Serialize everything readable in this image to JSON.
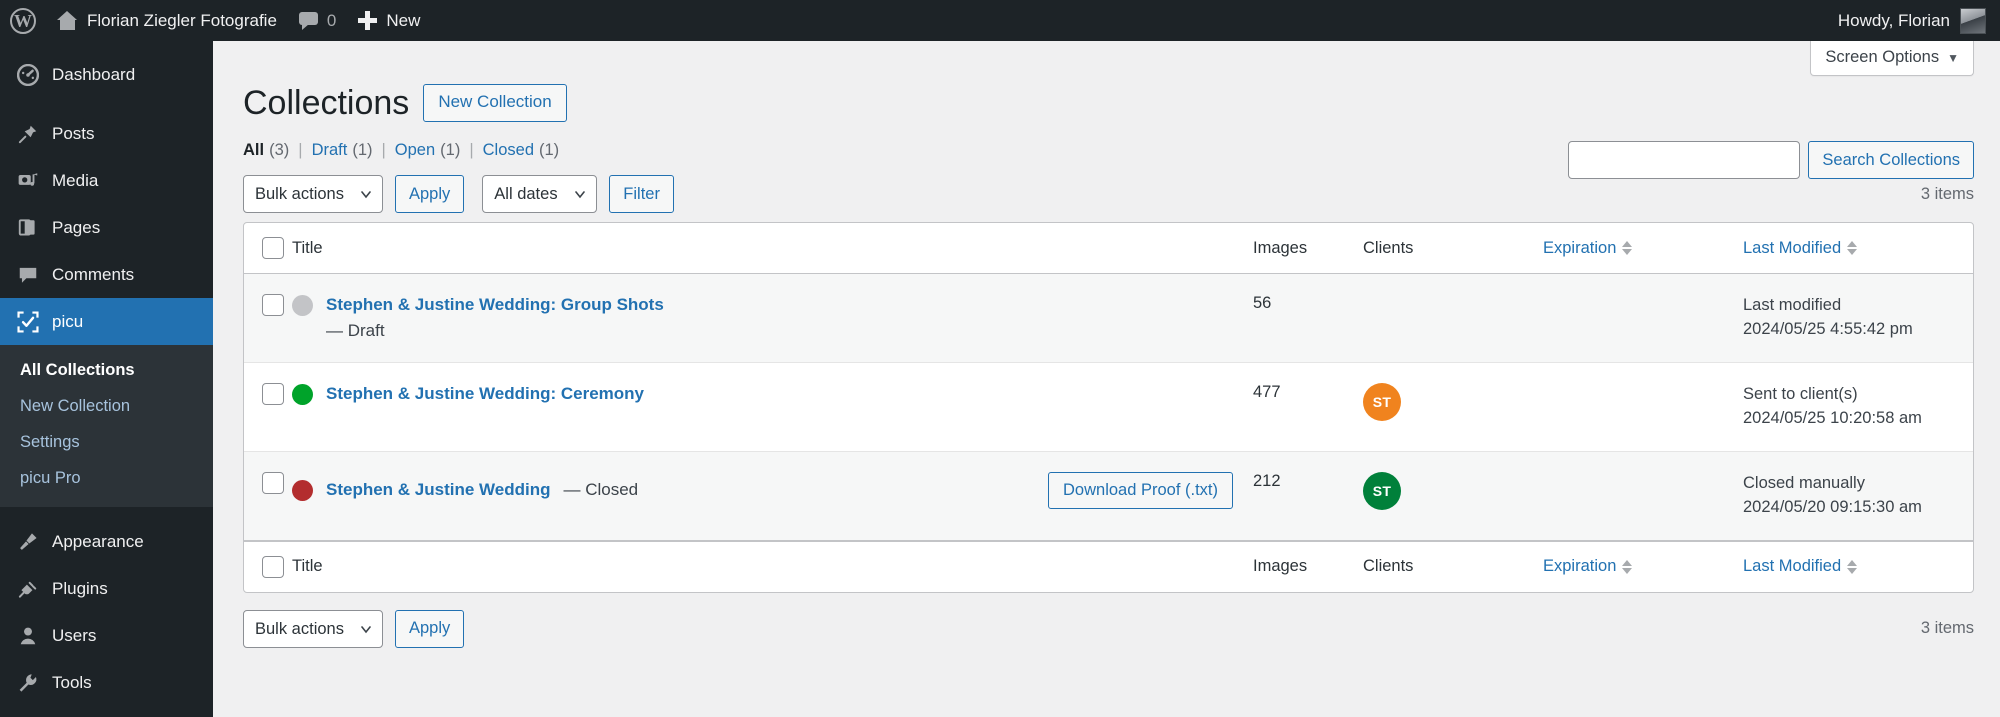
{
  "adminbar": {
    "wp_logo_icon": "wordpress-logo-icon",
    "home_icon": "home-icon",
    "site_name": "Florian Ziegler Fotografie",
    "comments_icon": "comment-bubble-icon",
    "comments_count": "0",
    "new_icon": "plus-icon",
    "new_label": "New",
    "howdy": "Howdy, Florian",
    "avatar_icon": "user-avatar"
  },
  "sidebar": {
    "items": [
      {
        "label": "Dashboard",
        "icon": "dashboard-icon",
        "current": false
      },
      {
        "label": "Posts",
        "icon": "pin-icon",
        "current": false
      },
      {
        "label": "Media",
        "icon": "media-icon",
        "current": false
      },
      {
        "label": "Pages",
        "icon": "pages-icon",
        "current": false
      },
      {
        "label": "Comments",
        "icon": "comment-bubble-icon",
        "current": false
      },
      {
        "label": "picu",
        "icon": "picu-checkbox-icon",
        "current": true
      },
      {
        "label": "Appearance",
        "icon": "paintbrush-icon",
        "current": false
      },
      {
        "label": "Plugins",
        "icon": "plug-icon",
        "current": false
      },
      {
        "label": "Users",
        "icon": "user-icon",
        "current": false
      },
      {
        "label": "Tools",
        "icon": "wrench-icon",
        "current": false
      }
    ],
    "submenu": [
      {
        "label": "All Collections",
        "current": true
      },
      {
        "label": "New Collection",
        "current": false
      },
      {
        "label": "Settings",
        "current": false
      },
      {
        "label": "picu Pro",
        "current": false
      }
    ]
  },
  "screen_options": {
    "label": "Screen Options",
    "caret_icon": "caret-down-icon"
  },
  "page": {
    "title": "Collections",
    "action_label": "New Collection"
  },
  "views": {
    "items": [
      {
        "label": "All",
        "count": "(3)",
        "current": true
      },
      {
        "label": "Draft",
        "count": "(1)",
        "current": false
      },
      {
        "label": "Open",
        "count": "(1)",
        "current": false
      },
      {
        "label": "Closed",
        "count": "(1)",
        "current": false
      }
    ],
    "divider": "|"
  },
  "search": {
    "value": "",
    "placeholder": "",
    "button_label": "Search Collections"
  },
  "tablenav_top": {
    "bulk_actions_selected": "Bulk actions",
    "apply_label": "Apply",
    "dates_selected": "All dates",
    "filter_label": "Filter",
    "displaying_num": "3 items"
  },
  "tablenav_bottom": {
    "bulk_actions_selected": "Bulk actions",
    "apply_label": "Apply",
    "displaying_num": "3 items"
  },
  "table": {
    "columns": {
      "title": "Title",
      "images": "Images",
      "clients": "Clients",
      "expiration": "Expiration",
      "last_modified": "Last Modified"
    },
    "rows": [
      {
        "status_color": "#c3c4c7",
        "status_name": "draft",
        "title": "Stephen & Justine Wedding: Group Shots",
        "state_suffix": "",
        "substate": "— Draft",
        "proof_button": "",
        "images": "56",
        "client_initials": "",
        "client_color": "",
        "modified_status": "Last modified",
        "modified_date": "2024/05/25 4:55:42 pm"
      },
      {
        "status_color": "#00a32a",
        "status_name": "open",
        "title": "Stephen & Justine Wedding: Ceremony",
        "state_suffix": "",
        "substate": "",
        "proof_button": "",
        "images": "477",
        "client_initials": "ST",
        "client_color": "#f0831e",
        "modified_status": "Sent to client(s)",
        "modified_date": "2024/05/25 10:20:58 am"
      },
      {
        "status_color": "#b32d2e",
        "status_name": "closed",
        "title": "Stephen & Justine Wedding",
        "state_suffix": "— Closed",
        "substate": "",
        "proof_button": "Download Proof (.txt)",
        "images": "212",
        "client_initials": "ST",
        "client_color": "#00803a",
        "modified_status": "Closed manually",
        "modified_date": "2024/05/20 09:15:30 am"
      }
    ]
  },
  "colors": {
    "admin_bg": "#1d2327",
    "accent_blue": "#2271b1",
    "current_menu": "#2271b1",
    "page_bg": "#f0f0f1"
  }
}
